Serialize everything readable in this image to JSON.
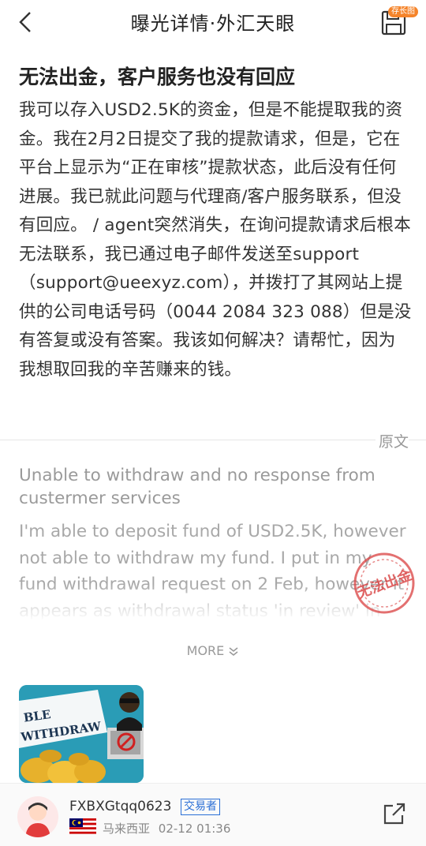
{
  "header": {
    "title": "曝光详情·外汇天眼",
    "save_badge": "存长图"
  },
  "complaint": {
    "title_zh": "无法出金，客户服务也没有回应",
    "body_zh": "我可以存入USD2.5K的资金，但是不能提取我的资金。我在2月2日提交了我的提款请求，但是，它在平台上显示为“正在审核”提款状态，此后没有任何进展。我已就此问题与代理商/客户服务联系，但没有回应。 / agent突然消失，在询问提款请求后根本无法联系，我已通过电子邮件发送至support （support@ueexyz.com），并拨打了其网站上提供的公司电话号码（0044 2084 323 088）但是没有答复或没有答案。我该如何解决？请帮忙，因为我想取回我的辛苦赚来的钱。",
    "original_label": "原文",
    "title_en": "Unable to withdraw and no response from custermer services",
    "body_en": "I'm able to deposit fund of USD2.5K, however not able to withdraw my fund. I put in my fund withdrawal request on 2 Feb, however it appears as withdrawal status 'in review' in the",
    "stamp_text": "无法出金",
    "more_label": "MORE"
  },
  "attachment": {
    "image_text_line1": "BLE",
    "image_text_line2": "WITHDRAW"
  },
  "footer": {
    "username": "FXBXGtqq0623",
    "role_badge": "交易者",
    "country": "马来西亚",
    "datetime": "02-12 01:36"
  },
  "colors": {
    "accent_orange": "#f5842a",
    "link_blue": "#2a6fd6",
    "stamp_red": "#d94040"
  }
}
